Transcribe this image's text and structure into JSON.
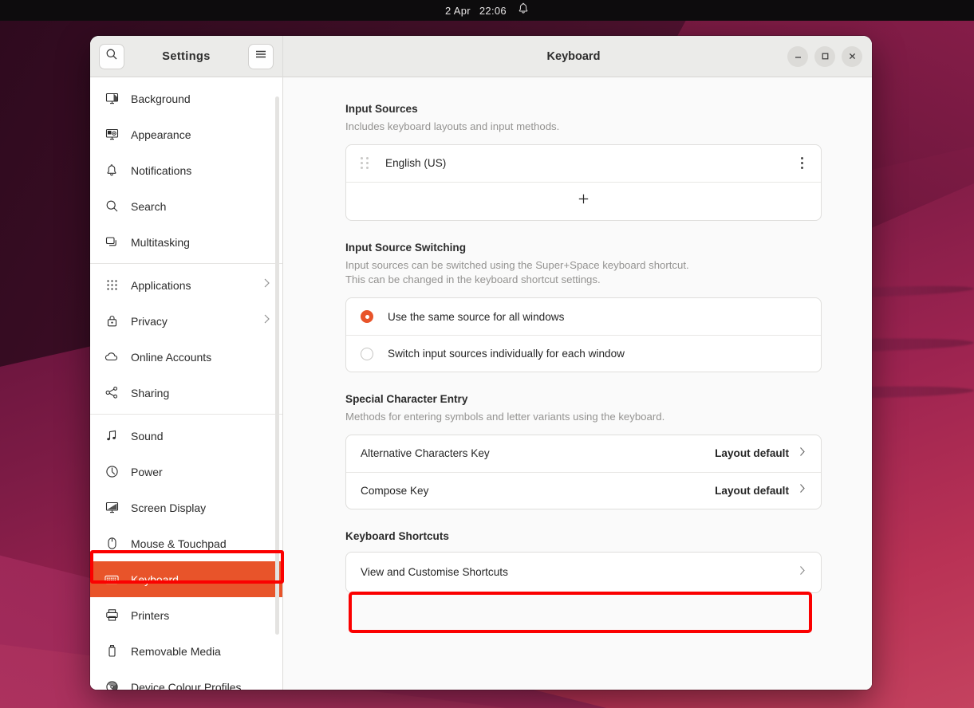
{
  "accent": "#E8542A",
  "annotation_color": "#FB0000",
  "topbar": {
    "date": "2 Apr",
    "time": "22:06",
    "bell_icon": "bell-icon"
  },
  "window": {
    "title": "Keyboard",
    "controls": {
      "minimize": "–",
      "maximize": "☐",
      "close": "×"
    }
  },
  "sidebar": {
    "title": "Settings",
    "search_icon": "search-icon",
    "menu_icon": "hamburger-menu-icon",
    "items": [
      {
        "label": "Background",
        "icon": "monitor-background-icon",
        "chevron": false,
        "selected": false
      },
      {
        "label": "Appearance",
        "icon": "appearance-monitor-icon",
        "chevron": false,
        "selected": false
      },
      {
        "label": "Notifications",
        "icon": "bell-icon",
        "chevron": false,
        "selected": false
      },
      {
        "label": "Search",
        "icon": "search-icon",
        "chevron": false,
        "selected": false
      },
      {
        "label": "Multitasking",
        "icon": "windows-stack-icon",
        "chevron": false,
        "selected": false
      },
      {
        "label": "Applications",
        "icon": "grid-dots-icon",
        "chevron": true,
        "selected": false
      },
      {
        "label": "Privacy",
        "icon": "lock-icon",
        "chevron": true,
        "selected": false
      },
      {
        "label": "Online Accounts",
        "icon": "cloud-icon",
        "chevron": false,
        "selected": false
      },
      {
        "label": "Sharing",
        "icon": "share-nodes-icon",
        "chevron": false,
        "selected": false
      },
      {
        "label": "Sound",
        "icon": "music-note-icon",
        "chevron": false,
        "selected": false
      },
      {
        "label": "Power",
        "icon": "power-icon",
        "chevron": false,
        "selected": false
      },
      {
        "label": "Screen Display",
        "icon": "screen-display-icon",
        "chevron": false,
        "selected": false
      },
      {
        "label": "Mouse & Touchpad",
        "icon": "mouse-icon",
        "chevron": false,
        "selected": false
      },
      {
        "label": "Keyboard",
        "icon": "keyboard-icon",
        "chevron": false,
        "selected": true
      },
      {
        "label": "Printers",
        "icon": "printer-icon",
        "chevron": false,
        "selected": false
      },
      {
        "label": "Removable Media",
        "icon": "usb-drive-icon",
        "chevron": false,
        "selected": false
      },
      {
        "label": "Device Colour Profiles",
        "icon": "colour-wheel-icon",
        "chevron": false,
        "selected": false
      }
    ],
    "separators_after": [
      4,
      6,
      8
    ]
  },
  "main": {
    "input_sources": {
      "title": "Input Sources",
      "description": "Includes keyboard layouts and input methods.",
      "sources": [
        {
          "label": "English (US)",
          "drag_handle_icon": "drag-handle-icon",
          "menu_icon": "kebab-menu-icon"
        }
      ],
      "add_label": "+"
    },
    "input_source_switching": {
      "title": "Input Source Switching",
      "description_line1": "Input sources can be switched using the Super+Space keyboard shortcut.",
      "description_line2": "This can be changed in the keyboard shortcut settings.",
      "options": [
        {
          "label": "Use the same source for all windows",
          "selected": true
        },
        {
          "label": "Switch input sources individually for each window",
          "selected": false
        }
      ]
    },
    "special_character_entry": {
      "title": "Special Character Entry",
      "description": "Methods for entering symbols and letter variants using the keyboard.",
      "rows": [
        {
          "label": "Alternative Characters Key",
          "value": "Layout default"
        },
        {
          "label": "Compose Key",
          "value": "Layout default"
        }
      ]
    },
    "keyboard_shortcuts": {
      "title": "Keyboard Shortcuts",
      "rows": [
        {
          "label": "View and Customise Shortcuts"
        }
      ]
    }
  }
}
